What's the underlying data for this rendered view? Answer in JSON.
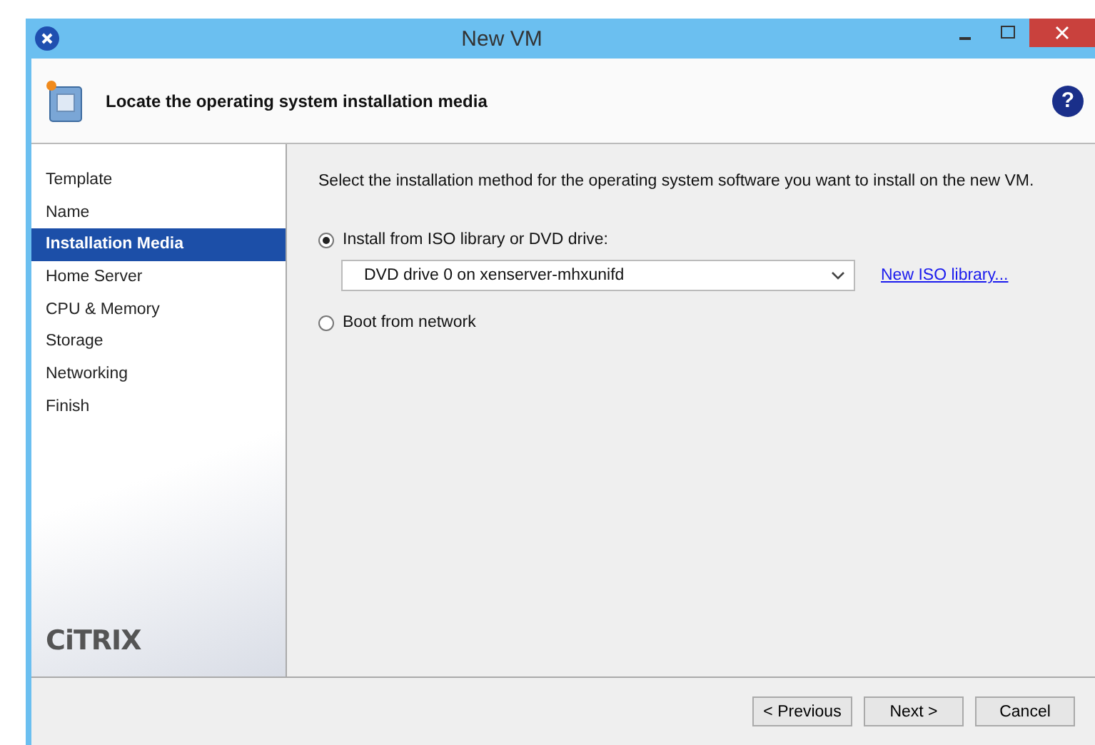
{
  "window": {
    "title": "New VM"
  },
  "header": {
    "title": "Locate the operating system installation media",
    "help": "?"
  },
  "sidebar": {
    "items": [
      {
        "label": "Template",
        "selected": false
      },
      {
        "label": "Name",
        "selected": false
      },
      {
        "label": "Installation Media",
        "selected": true
      },
      {
        "label": "Home Server",
        "selected": false
      },
      {
        "label": "CPU & Memory",
        "selected": false
      },
      {
        "label": "Storage",
        "selected": false
      },
      {
        "label": "Networking",
        "selected": false
      },
      {
        "label": "Finish",
        "selected": false
      }
    ],
    "logo": "CiTRIX"
  },
  "content": {
    "instruction": "Select the installation method for the operating system software you want to install on the new VM.",
    "options": [
      {
        "label": "Install from ISO library or DVD drive:",
        "selected": true,
        "dropdown": "DVD drive 0 on xenserver-mhxunifd",
        "link": "New ISO library..."
      },
      {
        "label": "Boot from network",
        "selected": false
      }
    ]
  },
  "buttons": [
    "< Previous",
    "Next >",
    "Cancel"
  ]
}
